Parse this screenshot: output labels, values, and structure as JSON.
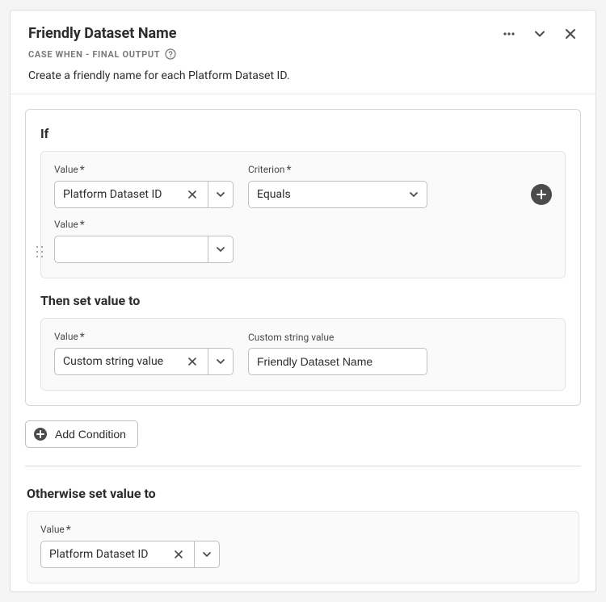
{
  "header": {
    "title": "Friendly Dataset Name",
    "subtitle": "CASE WHEN - FINAL OUTPUT",
    "description": "Create a friendly name for each Platform Dataset ID."
  },
  "rule": {
    "if_label": "If",
    "then_label": "Then set value to",
    "condition": {
      "value1": {
        "label": "Value",
        "value": "Platform Dataset ID"
      },
      "criterion": {
        "label": "Criterion",
        "value": "Equals"
      },
      "value2": {
        "label": "Value",
        "value": ""
      }
    },
    "then": {
      "type": {
        "label": "Value",
        "value": "Custom string value"
      },
      "custom": {
        "label": "Custom string value",
        "value": "Friendly Dataset Name"
      }
    }
  },
  "add_condition_label": "Add Condition",
  "otherwise": {
    "label": "Otherwise set value to",
    "value_label": "Value",
    "value": "Platform Dataset ID"
  }
}
